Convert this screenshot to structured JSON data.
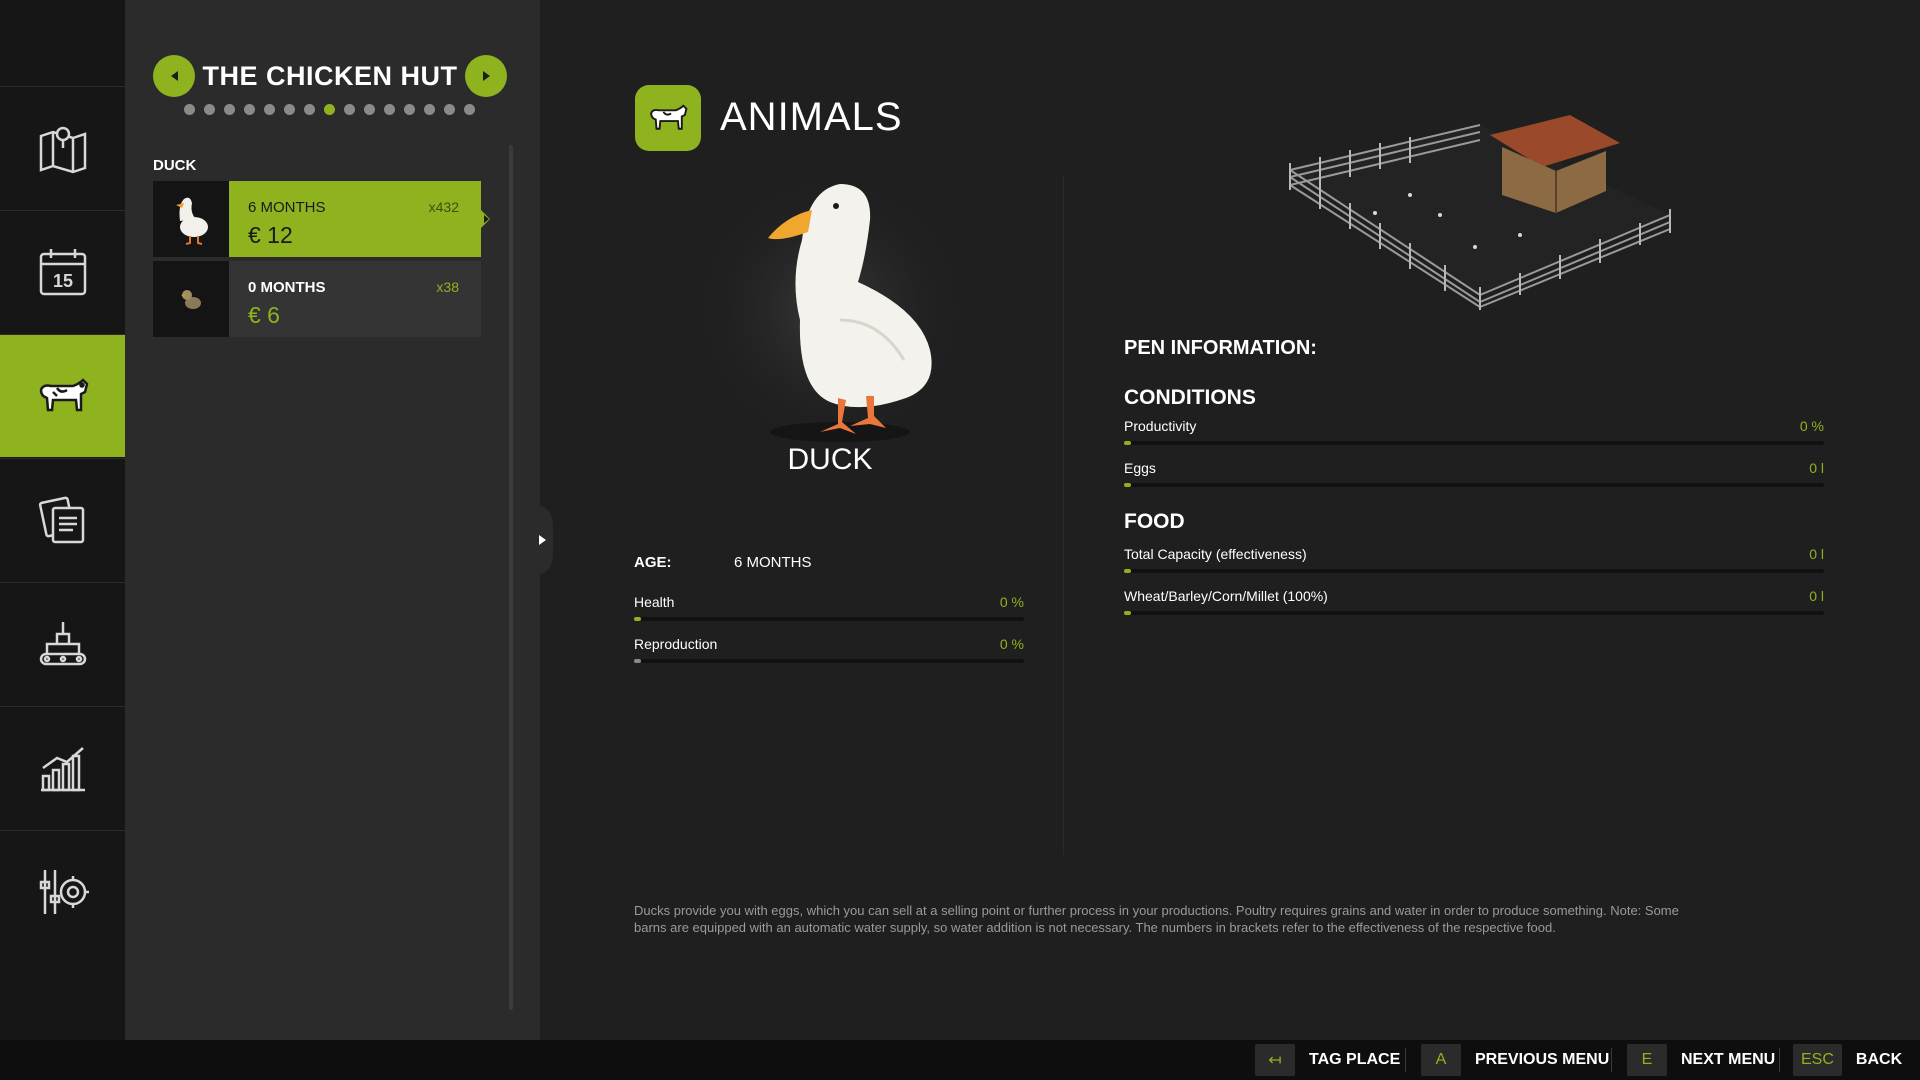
{
  "sidebar": {
    "items": [
      {
        "name": "map",
        "icon": "map-icon"
      },
      {
        "name": "calendar",
        "icon": "calendar-icon",
        "label": "15"
      },
      {
        "name": "animals",
        "icon": "cow-icon",
        "active": true
      },
      {
        "name": "contracts",
        "icon": "documents-icon"
      },
      {
        "name": "production",
        "icon": "factory-icon"
      },
      {
        "name": "statistics",
        "icon": "chart-icon"
      },
      {
        "name": "settings",
        "icon": "settings-icon"
      }
    ]
  },
  "list_panel": {
    "title": "THE CHICKEN HUT",
    "page_count": 15,
    "active_page": 8,
    "group_label": "DUCK",
    "rows": [
      {
        "age": "6 MONTHS",
        "count": "x432",
        "price": "€ 12",
        "selected": true
      },
      {
        "age": "0 MONTHS",
        "count": "x38",
        "price": "€ 6",
        "selected": false
      }
    ]
  },
  "main": {
    "title": "ANIMALS",
    "animal_name": "DUCK",
    "age_label": "AGE:",
    "age_value": "6 MONTHS",
    "stats": [
      {
        "name": "Health",
        "value": "0 %",
        "level": 0
      },
      {
        "name": "Reproduction",
        "value": "0 %",
        "level": 0
      }
    ],
    "description": "Ducks provide you with eggs, which you can sell at a selling point or further process in your productions. Poultry requires grains and water in order to produce something. Note: Some barns are equipped with an automatic water supply, so water addition is not necessary. The numbers in brackets refer to the effectiveness of the respective food."
  },
  "pen": {
    "title": "PEN INFORMATION:",
    "conditions_title": "CONDITIONS",
    "conditions": [
      {
        "name": "Productivity",
        "value": "0 %",
        "level": 0
      },
      {
        "name": "Eggs",
        "value": "0 l",
        "level": 0
      }
    ],
    "food_title": "FOOD",
    "food": [
      {
        "name": "Total Capacity (effectiveness)",
        "value": "0 l",
        "level": 0
      },
      {
        "name": "Wheat/Barley/Corn/Millet (100%)",
        "value": "0 l",
        "level": 0
      }
    ]
  },
  "bottom_bar": {
    "hints": [
      {
        "key": "↤",
        "label": "TAG PLACE"
      },
      {
        "key": "A",
        "label": "PREVIOUS MENU"
      },
      {
        "key": "E",
        "label": "NEXT MENU"
      },
      {
        "key": "ESC",
        "label": "BACK"
      }
    ]
  },
  "colors": {
    "accent": "#8fb31f",
    "background": "#1f1f1f",
    "panel": "#2a2b2a",
    "sidebar": "#161616"
  }
}
